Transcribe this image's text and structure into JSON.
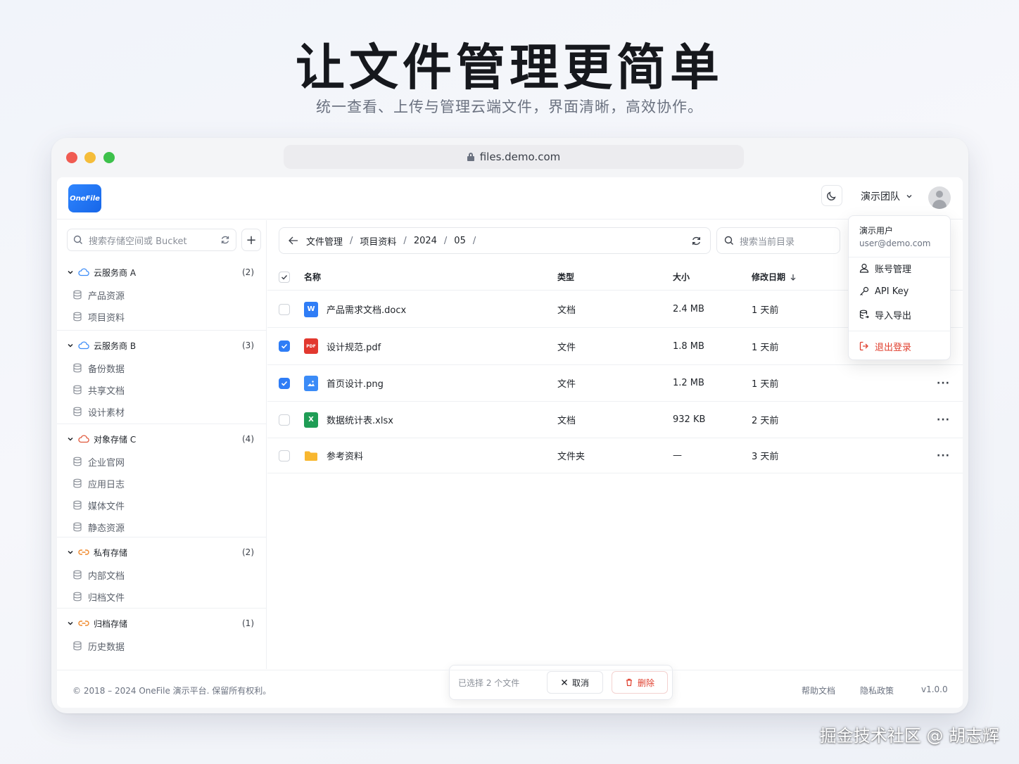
{
  "hero": {
    "title": "让文件管理更简单",
    "subtitle": "统一查看、上传与管理云端文件，界面清晰，高效协作。"
  },
  "browser": {
    "url": "files.demo.com"
  },
  "header": {
    "logo_text": "OneFile",
    "team_label": "演示团队"
  },
  "user_menu": {
    "name": "演示用户",
    "email": "user@demo.com",
    "items": [
      {
        "label": "账号管理",
        "icon": "user-icon"
      },
      {
        "label": "API Key",
        "icon": "key-icon"
      },
      {
        "label": "导入导出",
        "icon": "database-export-icon"
      }
    ],
    "logout": "退出登录"
  },
  "sidebar": {
    "search_placeholder": "搜索存储空间或 Bucket",
    "groups": [
      {
        "name": "云服务商 A",
        "count": "(2)",
        "icon": "cloud-icon",
        "buckets": [
          "产品资源",
          "项目资料"
        ]
      },
      {
        "name": "云服务商 B",
        "count": "(3)",
        "icon": "cloud-icon",
        "buckets": [
          "备份数据",
          "共享文档",
          "设计素材"
        ]
      },
      {
        "name": "对象存储 C",
        "count": "(4)",
        "icon": "cloud-icon",
        "buckets": [
          "企业官网",
          "应用日志",
          "媒体文件",
          "静态资源"
        ]
      },
      {
        "name": "私有存储",
        "count": "(2)",
        "icon": "link-icon",
        "buckets": [
          "内部文档",
          "归档文件"
        ]
      },
      {
        "name": "归档存储",
        "count": "(1)",
        "icon": "link-icon",
        "buckets": [
          "历史数据"
        ]
      }
    ]
  },
  "breadcrumb": [
    "文件管理",
    "项目资料",
    "2024",
    "05"
  ],
  "dir_search_placeholder": "搜索当前目录",
  "table": {
    "columns": {
      "name": "名称",
      "type": "类型",
      "size": "大小",
      "modified": "修改日期"
    },
    "rows": [
      {
        "name": "产品需求文档.docx",
        "type": "文档",
        "size": "2.4 MB",
        "modified": "1 天前",
        "checked": false,
        "icon": "word-file-icon"
      },
      {
        "name": "设计规范.pdf",
        "type": "文件",
        "size": "1.8 MB",
        "modified": "1 天前",
        "checked": true,
        "icon": "pdf-file-icon"
      },
      {
        "name": "首页设计.png",
        "type": "文件",
        "size": "1.2 MB",
        "modified": "1 天前",
        "checked": true,
        "icon": "image-file-icon"
      },
      {
        "name": "数据统计表.xlsx",
        "type": "文档",
        "size": "932 KB",
        "modified": "2 天前",
        "checked": false,
        "icon": "excel-file-icon"
      },
      {
        "name": "参考资料",
        "type": "文件夹",
        "size": "—",
        "modified": "3 天前",
        "checked": false,
        "icon": "folder-icon"
      }
    ]
  },
  "selection_bar": {
    "text": "已选择 2 个文件",
    "cancel": "取消",
    "delete": "删除"
  },
  "footer": {
    "copyright": "© 2018 – 2024 OneFile 演示平台. 保留所有权利。",
    "help": "帮助文档",
    "privacy": "隐私政策",
    "version": "v1.0.0"
  },
  "watermark": "掘金技术社区 @ 胡志辉",
  "colors": {
    "accent": "#2f7df6",
    "danger": "#e0402f",
    "traffic_red": "#f05b52",
    "traffic_yellow": "#f5bd3a",
    "traffic_green": "#3dc14b"
  }
}
